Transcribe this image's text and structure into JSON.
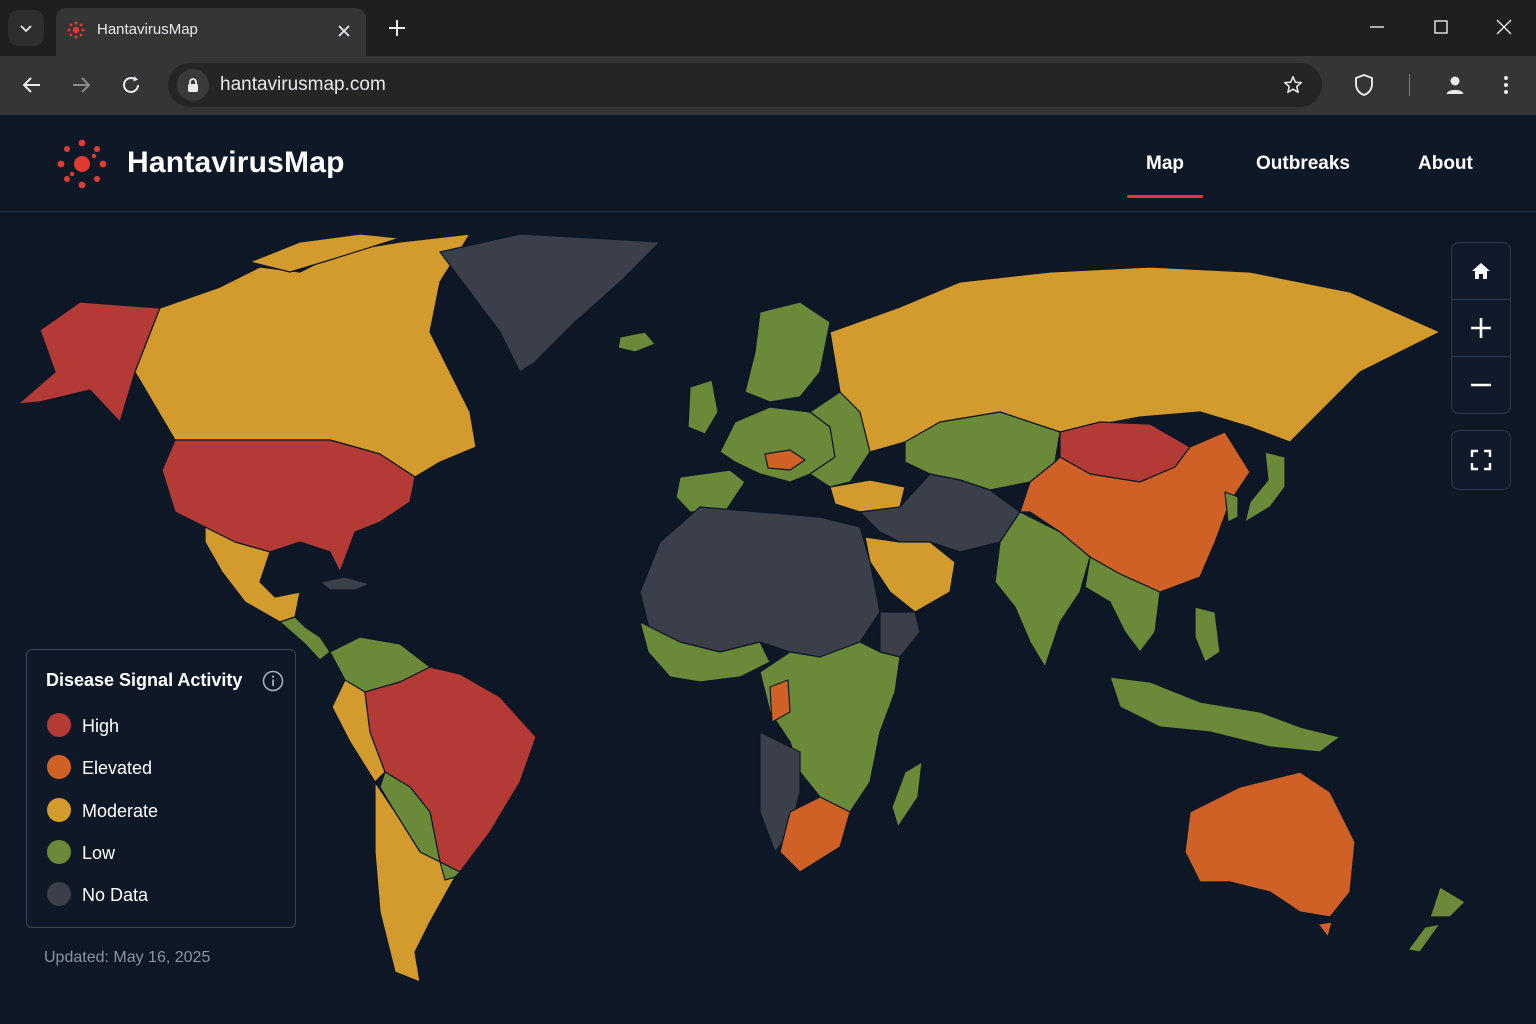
{
  "browser": {
    "tab_title": "HantavirusMap",
    "url": "hantavirusmap.com"
  },
  "site": {
    "name": "HantavirusMap",
    "nav": [
      {
        "label": "Map",
        "active": true
      },
      {
        "label": "Outbreaks",
        "active": false
      },
      {
        "label": "About",
        "active": false
      }
    ],
    "accent": "#e03a33"
  },
  "map": {
    "controls": [
      "home-icon",
      "zoom-in-icon",
      "zoom-out-icon",
      "fullscreen-icon"
    ],
    "levels": {
      "high": "#b33a35",
      "elevated": "#cf6127",
      "moderate": "#d39a2d",
      "low": "#6a8a3a",
      "nodata": "#3a3f4a"
    },
    "regions": [
      {
        "region": "Alaska",
        "level": "high"
      },
      {
        "region": "Canada",
        "level": "moderate"
      },
      {
        "region": "United States",
        "level": "high"
      },
      {
        "region": "Mexico",
        "level": "moderate"
      },
      {
        "region": "Central America",
        "level": "low"
      },
      {
        "region": "Greenland",
        "level": "nodata"
      },
      {
        "region": "Brazil",
        "level": "high"
      },
      {
        "region": "Argentina",
        "level": "moderate"
      },
      {
        "region": "Western Europe",
        "level": "low"
      },
      {
        "region": "Russia",
        "level": "moderate"
      },
      {
        "region": "China",
        "level": "elevated"
      },
      {
        "region": "Mongolia",
        "level": "high"
      },
      {
        "region": "India",
        "level": "low"
      },
      {
        "region": "North Africa",
        "level": "nodata"
      },
      {
        "region": "Central Africa",
        "level": "low"
      },
      {
        "region": "South Africa",
        "level": "elevated"
      },
      {
        "region": "Australia",
        "level": "elevated"
      },
      {
        "region": "New Zealand",
        "level": "low"
      }
    ]
  },
  "legend": {
    "title": "Disease Signal Activity",
    "items": [
      {
        "label": "High",
        "color": "#b33a35"
      },
      {
        "label": "Elevated",
        "color": "#cf6127"
      },
      {
        "label": "Moderate",
        "color": "#d39a2d"
      },
      {
        "label": "Low",
        "color": "#6a8a3a"
      },
      {
        "label": "No Data",
        "color": "#3a3f4a"
      }
    ]
  },
  "updated": "Updated: May 16, 2025"
}
